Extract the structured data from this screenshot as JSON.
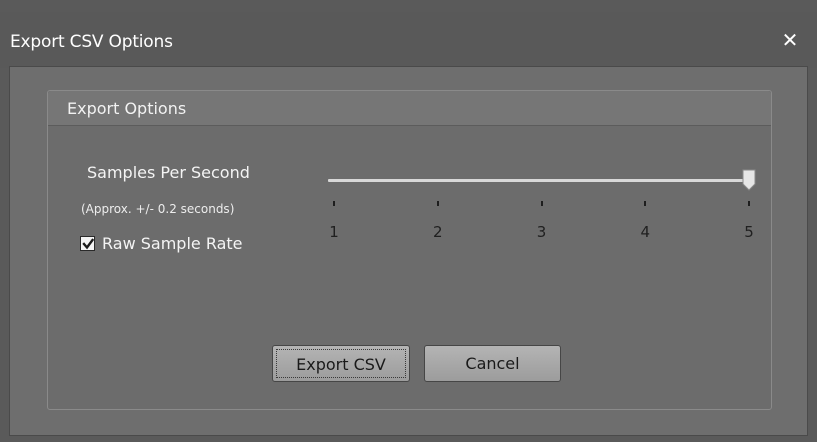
{
  "window": {
    "title": "Export CSV Options",
    "close_glyph": "✕"
  },
  "group": {
    "title": "Export Options"
  },
  "samples": {
    "label": "Samples Per Second",
    "note": "(Approx. +/- 0.2 seconds)"
  },
  "raw_sample_rate": {
    "label": "Raw Sample Rate",
    "checked": true
  },
  "slider": {
    "min": 1,
    "max": 5,
    "value": 5,
    "ticks": [
      "1",
      "2",
      "3",
      "4",
      "5"
    ]
  },
  "buttons": {
    "export_label": "Export CSV",
    "cancel_label": "Cancel"
  },
  "colors": {
    "window_bg": "#5a5a5a",
    "panel_bg": "#6e6e6e",
    "button_bg": "#a8a8a8"
  }
}
